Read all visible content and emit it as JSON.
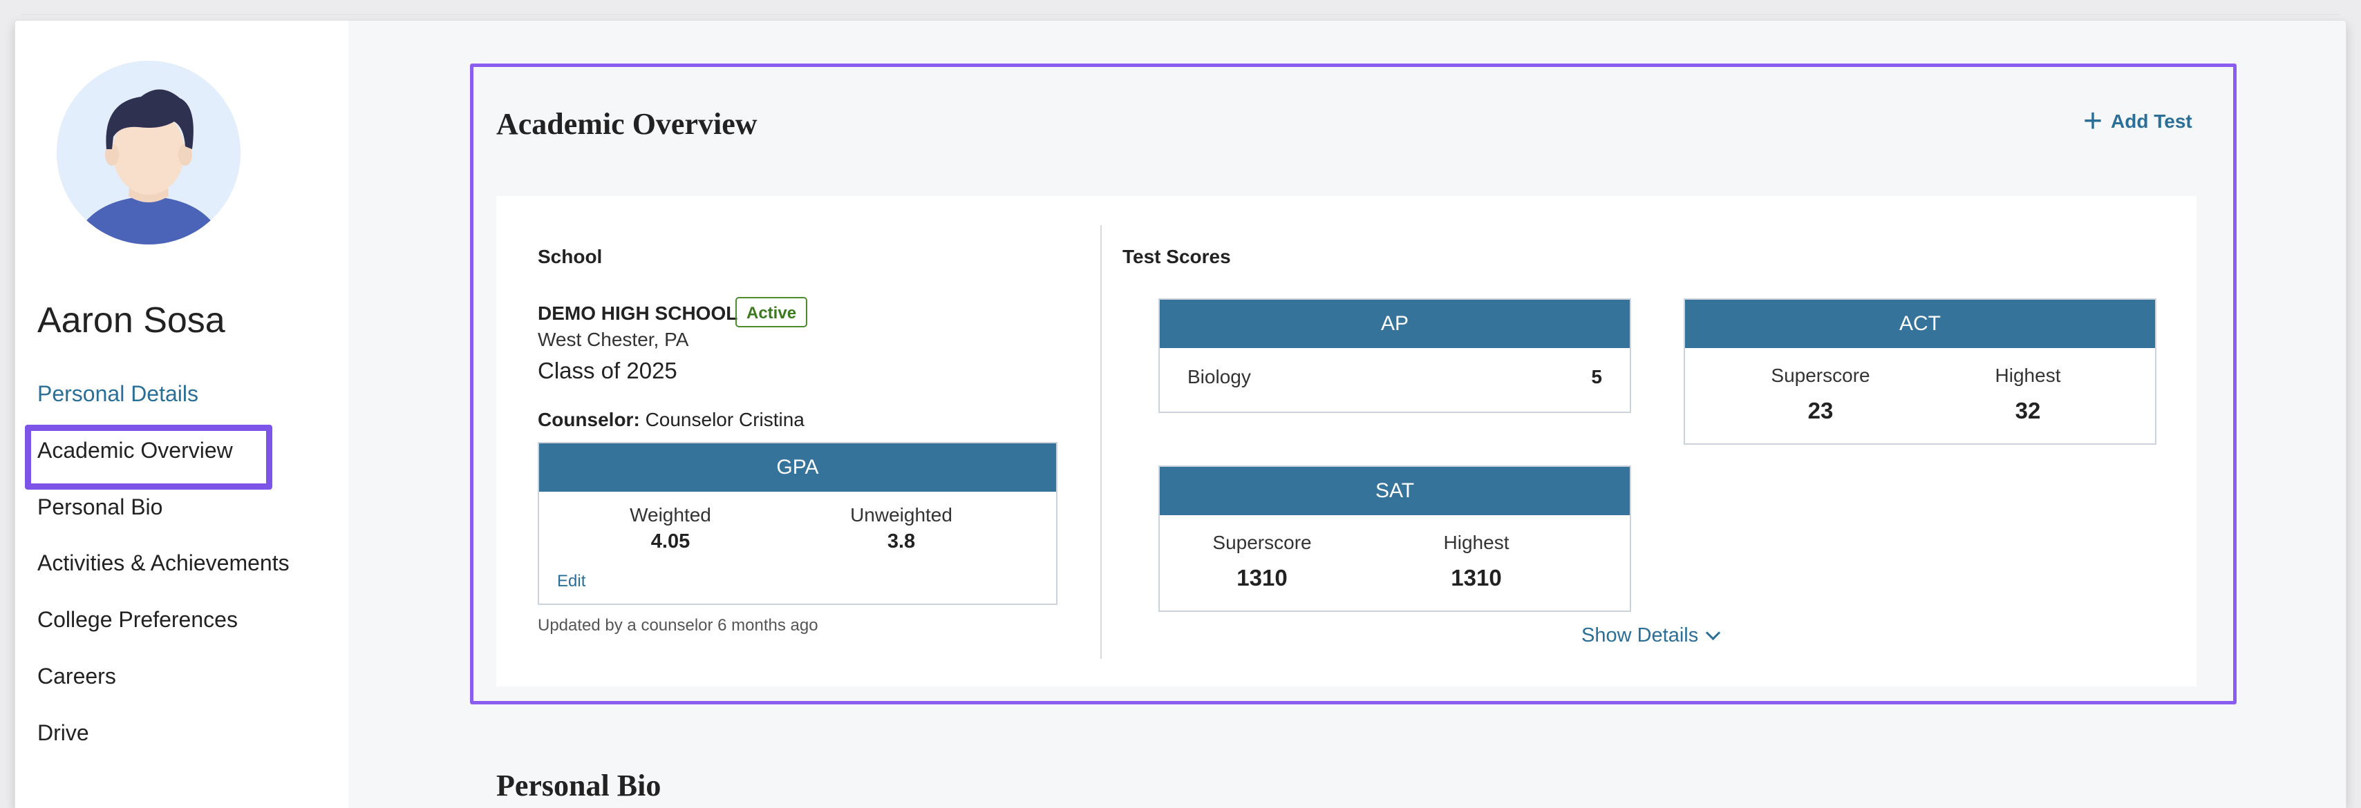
{
  "student": {
    "name": "Aaron Sosa"
  },
  "sidebar": {
    "items": [
      {
        "label": "Personal Details"
      },
      {
        "label": "Academic Overview"
      },
      {
        "label": "Personal Bio"
      },
      {
        "label": "Activities & Achievements"
      },
      {
        "label": "College Preferences"
      },
      {
        "label": "Careers"
      },
      {
        "label": "Drive"
      }
    ]
  },
  "academic": {
    "title": "Academic Overview",
    "add_test_label": "Add Test",
    "school": {
      "section_label": "School",
      "name": "DEMO HIGH SCHOOL",
      "status": "Active",
      "location": "West Chester, PA",
      "class_of": "Class of 2025",
      "counselor_label": "Counselor:",
      "counselor_name": "Counselor Cristina"
    },
    "gpa": {
      "title": "GPA",
      "weighted_label": "Weighted",
      "weighted_value": "4.05",
      "unweighted_label": "Unweighted",
      "unweighted_value": "3.8",
      "edit_label": "Edit",
      "updated_text": "Updated by a counselor 6 months ago"
    },
    "test_scores": {
      "section_label": "Test Scores",
      "ap": {
        "title": "AP",
        "subject": "Biology",
        "score": "5"
      },
      "act": {
        "title": "ACT",
        "superscore_label": "Superscore",
        "superscore": "23",
        "highest_label": "Highest",
        "highest": "32"
      },
      "sat": {
        "title": "SAT",
        "superscore_label": "Superscore",
        "superscore": "1310",
        "highest_label": "Highest",
        "highest": "1310"
      },
      "show_details_label": "Show Details"
    }
  },
  "next_section": {
    "title": "Personal Bio"
  },
  "colors": {
    "accent": "#2a6f97",
    "header_blue": "#36739a",
    "highlight": "#7c54e8",
    "active_green": "#3b7a1f"
  }
}
